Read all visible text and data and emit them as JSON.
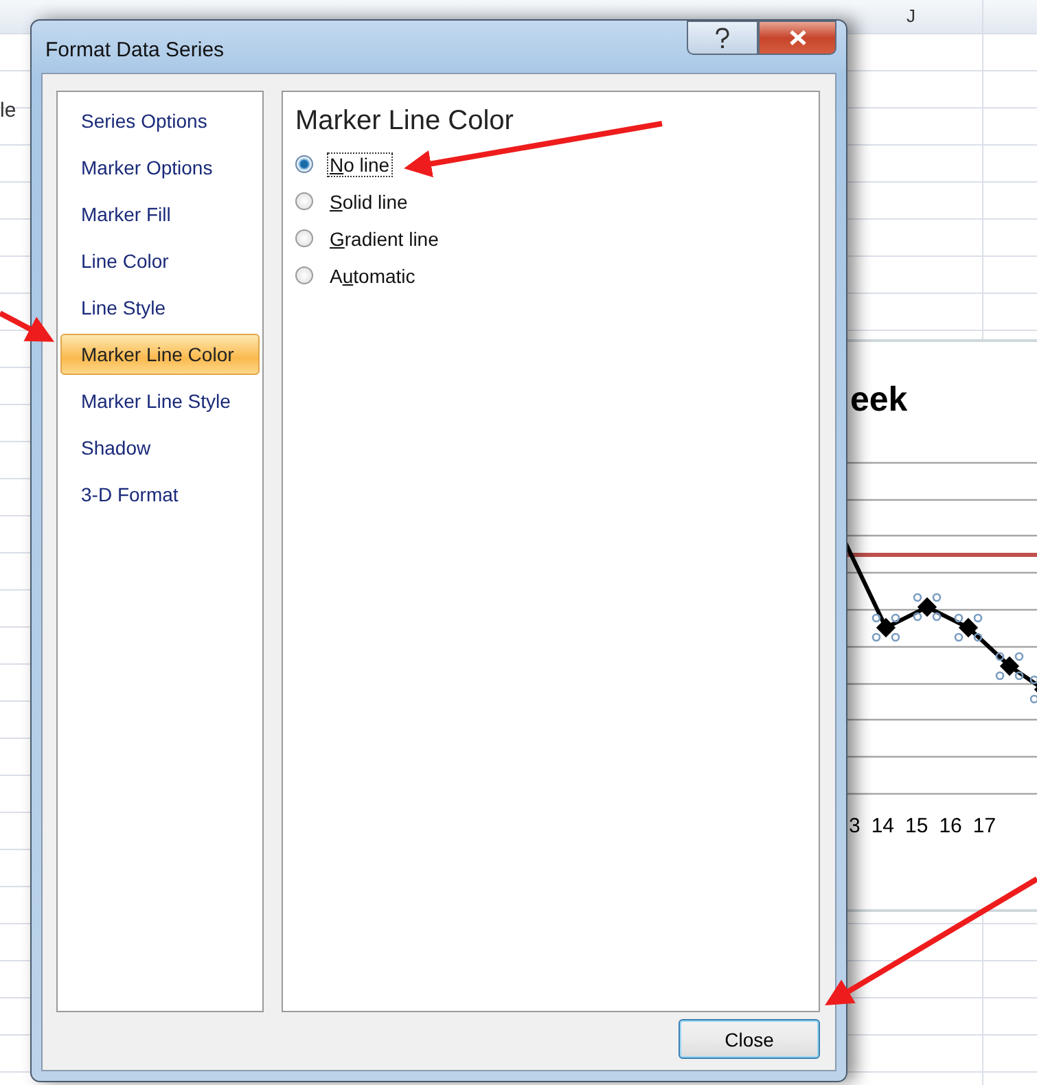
{
  "sheet": {
    "column_header": "J",
    "cell_fragment": "le"
  },
  "chart": {
    "title_fragment": "eek",
    "x_labels": [
      "3",
      "14",
      "15",
      "16",
      "17"
    ]
  },
  "dialog": {
    "title": "Format Data Series",
    "nav": [
      {
        "label": "Series Options",
        "selected": false
      },
      {
        "label": "Marker Options",
        "selected": false
      },
      {
        "label": "Marker Fill",
        "selected": false
      },
      {
        "label": "Line Color",
        "selected": false
      },
      {
        "label": "Line Style",
        "selected": false
      },
      {
        "label": "Marker Line Color",
        "selected": true
      },
      {
        "label": "Marker Line Style",
        "selected": false
      },
      {
        "label": "Shadow",
        "selected": false
      },
      {
        "label": "3-D Format",
        "selected": false
      }
    ],
    "panel": {
      "heading": "Marker Line Color",
      "options": [
        {
          "label": [
            {
              "text": "N",
              "underlined": true
            },
            {
              "text": "o line",
              "underlined": false
            }
          ],
          "selected": true,
          "focused": true
        },
        {
          "label": [
            {
              "text": "S",
              "underlined": true
            },
            {
              "text": "olid line",
              "underlined": false
            }
          ],
          "selected": false,
          "focused": false
        },
        {
          "label": [
            {
              "text": "G",
              "underlined": true
            },
            {
              "text": "radient line",
              "underlined": false
            }
          ],
          "selected": false,
          "focused": false
        },
        {
          "label": [
            {
              "text": "A",
              "underlined": false
            },
            {
              "text": "u",
              "underlined": true
            },
            {
              "text": "tomatic",
              "underlined": false
            }
          ],
          "selected": false,
          "focused": false
        }
      ]
    },
    "close_button": "Close"
  }
}
